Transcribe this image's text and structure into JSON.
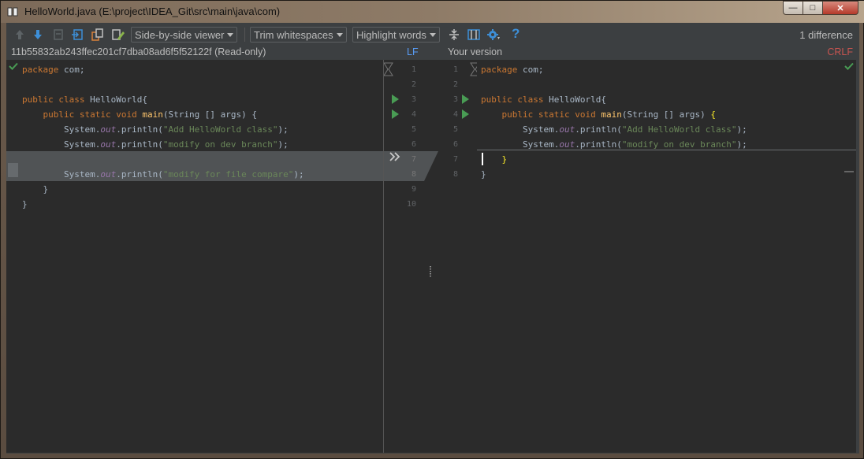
{
  "window": {
    "title": "HelloWorld.java (E:\\project\\IDEA_Git\\src\\main\\java\\com)",
    "controls": {
      "minimize": "—",
      "maximize": "□",
      "close": "✕"
    }
  },
  "toolbar": {
    "viewer_label": "Side-by-side viewer",
    "whitespace_label": "Trim whitespaces",
    "highlight_label": "Highlight words",
    "help_label": "?",
    "diff_count": "1 difference"
  },
  "left_header": {
    "revision": "11b55832ab243ffec201cf7dba08ad6f5f52122f (Read-only)",
    "line_separator": "LF"
  },
  "right_header": {
    "title": "Your version",
    "line_separator": "CRLF"
  },
  "left_code": {
    "l1": {
      "a": "package",
      "b": " com;"
    },
    "l3": {
      "a": "public class",
      "b": " HelloWorld{"
    },
    "l4": {
      "a": "    public static void",
      "m": " main",
      "b": "(String [] args) {"
    },
    "l5": {
      "a": "        System.",
      "f": "out",
      "b": ".println(",
      "s": "\"Add HelloWorld class\"",
      "e": ");"
    },
    "l6": {
      "a": "        System.",
      "f": "out",
      "b": ".println(",
      "s": "\"modify on dev branch\"",
      "e": ");"
    },
    "l8": {
      "a": "        System.",
      "f": "out",
      "b": ".println(",
      "s": "\"modify for file compare\"",
      "e": ");"
    },
    "l9": "    }",
    "l10": "}"
  },
  "right_code": {
    "l1": {
      "a": "package",
      "b": " com;"
    },
    "l3": {
      "a": "public class",
      "b": " HelloWorld{"
    },
    "l4": {
      "a": "    public static void",
      "m": " main",
      "b": "(String [] args) ",
      "h": "{"
    },
    "l5": {
      "a": "        System.",
      "f": "out",
      "b": ".println(",
      "s": "\"Add HelloWorld class\"",
      "e": ");"
    },
    "l6": {
      "a": "        System.",
      "f": "out",
      "b": ".println(",
      "s": "\"modify on dev branch\"",
      "e": ");"
    },
    "l7": {
      "h": "    }"
    },
    "l8": "}"
  },
  "left_line_numbers": [
    "1",
    "2",
    "3",
    "4",
    "5",
    "6",
    "7",
    "8",
    "9",
    "10"
  ],
  "right_line_numbers": [
    "1",
    "2",
    "3",
    "4",
    "5",
    "6",
    "7",
    "8"
  ],
  "colors": {
    "background": "#2b2b2b",
    "chrome": "#3c3f41",
    "keyword": "#cc7832",
    "string": "#6a8759",
    "accent_lf": "#589df6",
    "accent_crlf": "#c75450",
    "change_green": "#499c54"
  },
  "icons": [
    "arrow-up-icon",
    "arrow-down-icon",
    "prev-file-icon",
    "next-file-icon",
    "compare-files-icon",
    "edit-source-icon",
    "collapse-unchanged-icon",
    "sync-scroll-icon",
    "settings-gear-icon",
    "help-icon",
    "check-icon",
    "apply-change-icon"
  ]
}
